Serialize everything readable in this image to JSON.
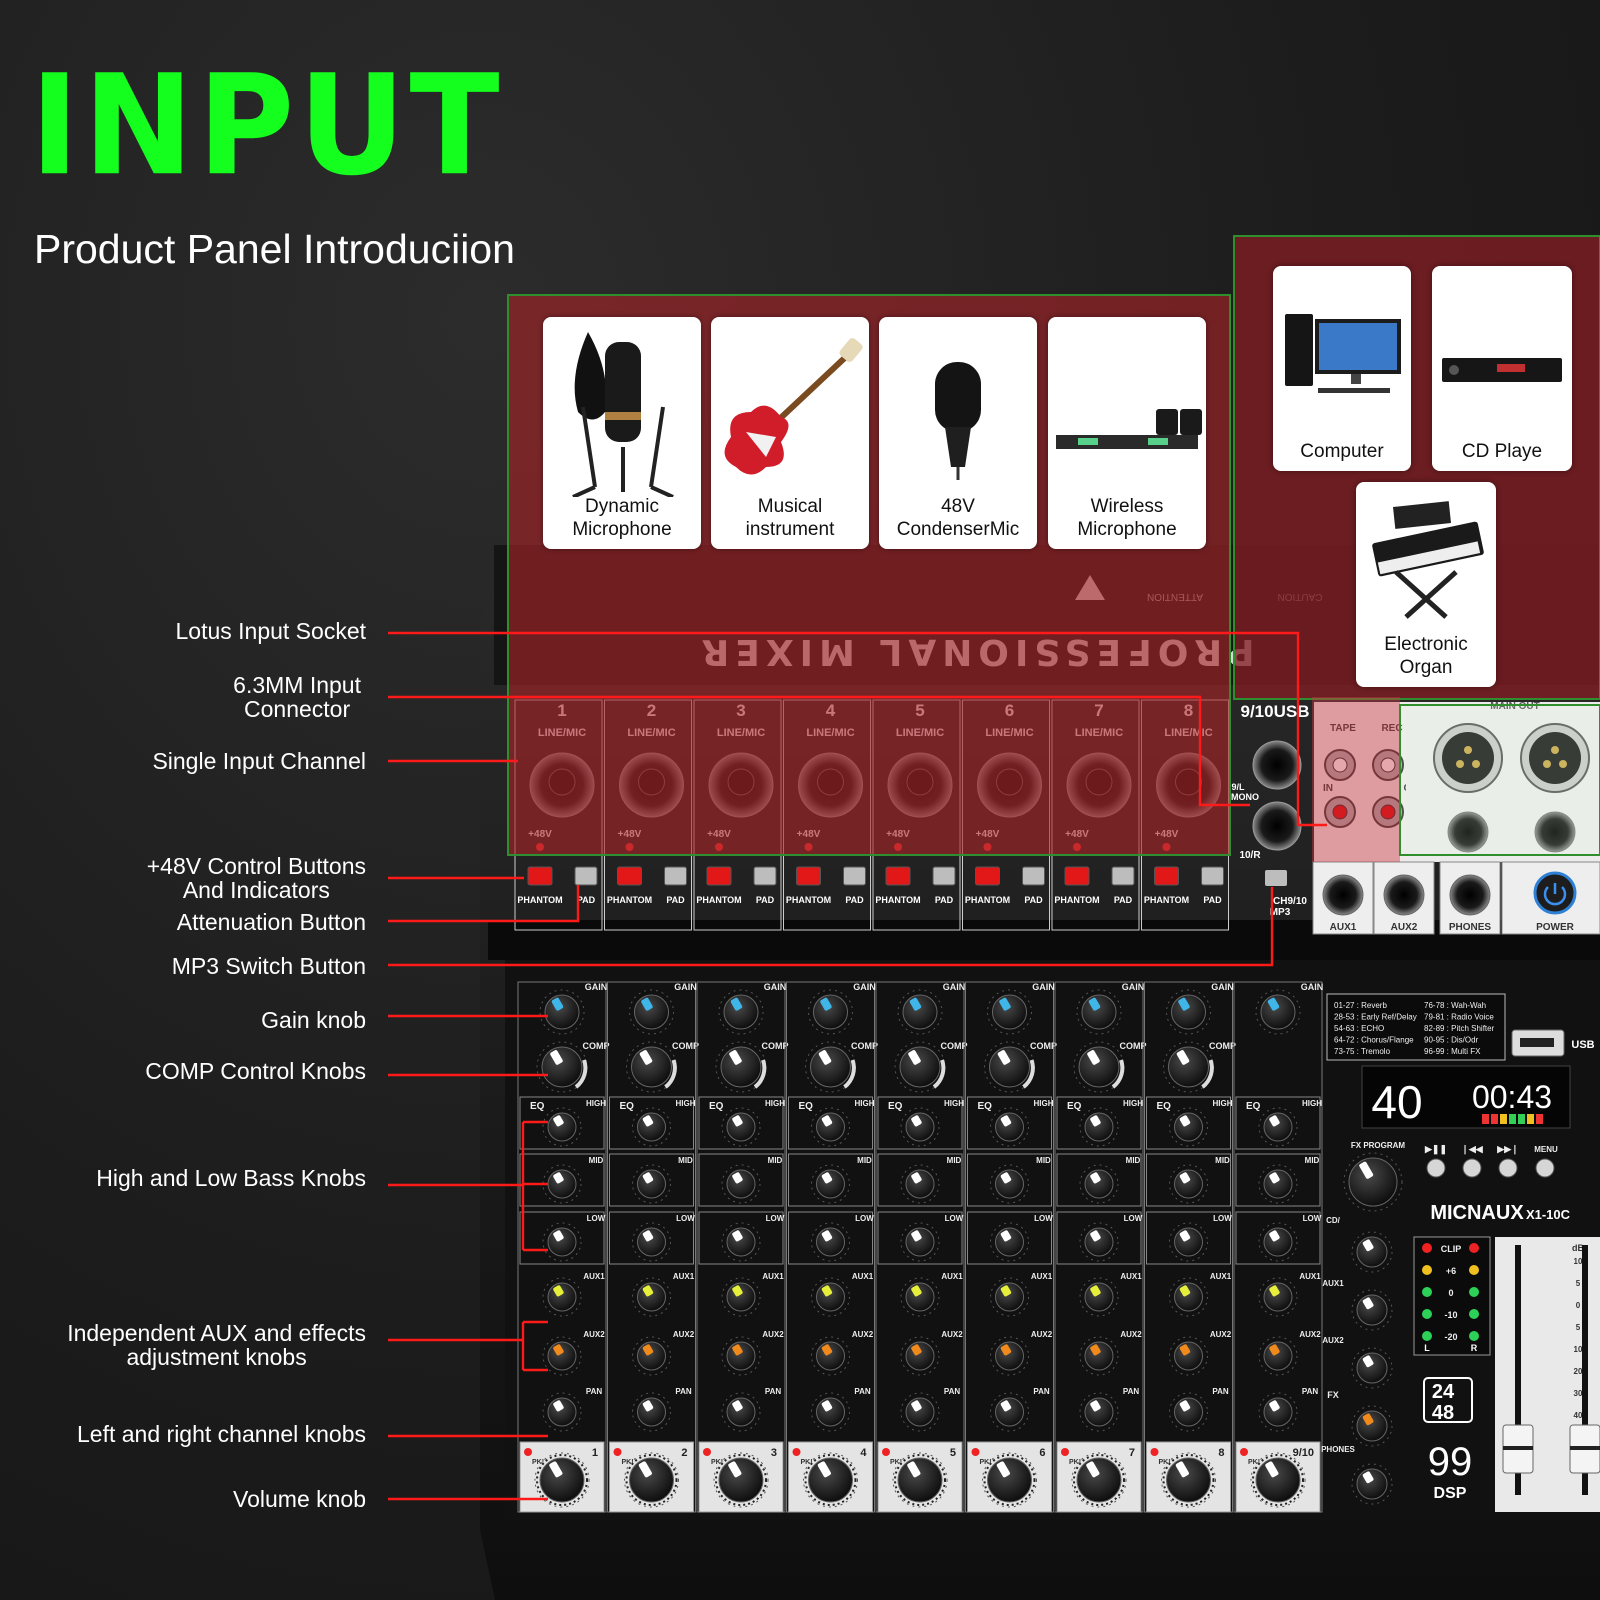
{
  "header": {
    "title": "INPUT",
    "subtitle": "Product Panel Introduciion"
  },
  "devices": {
    "dynamic_mic": "Dynamic\nMicrophone",
    "instrument": "Musical\ninstrument",
    "condenser": "48V\nCondenserMic",
    "wireless": "Wireless\nMicrophone",
    "computer": "Computer",
    "cd_player": "CD Playe",
    "organ": "Electronic\nOrgan"
  },
  "callouts": {
    "lotus": "Lotus Input Socket",
    "jack": "6.3MM Input\nConnector",
    "single_channel": "Single Input Channel",
    "phantom": "+48V Control Buttons\nAnd Indicators",
    "attenuation": "Attenuation Button",
    "mp3_switch": "MP3 Switch Button",
    "gain": "Gain knob",
    "comp": "COMP Control Knobs",
    "eq": "High and Low Bass Knobs",
    "aux": "Independent AUX and effects\nadjustment knobs",
    "pan": "Left and right channel knobs",
    "volume": "Volume knob"
  },
  "mixer": {
    "channel_numbers": [
      "1",
      "2",
      "3",
      "4",
      "5",
      "6",
      "7",
      "8"
    ],
    "usb_channel": "9/10USB",
    "line_mic": "LINE/MIC",
    "plus48": "+48V",
    "phantom": "PHANTOM",
    "pad": "PAD",
    "mono_label": "9/L\nMONO",
    "ten_r": "10/R",
    "mp3_label": "CH9/10\nMP3",
    "tape": "TAPE",
    "rec": "REC",
    "main_out": "MAIN OUT",
    "in": "IN",
    "out": "OUT",
    "aux1": "AUX1",
    "aux2": "AUX2",
    "phones": "PHONES",
    "power": "POWER",
    "top_text": "PROFESSIONAL MIXER",
    "caution": "CAUTION",
    "attention": "ATTENTION",
    "gain": "GAIN",
    "comp": "COMP",
    "eq": "EQ",
    "high": "HIGH",
    "mid": "MID",
    "low": "LOW",
    "aux1_knob": "AUX1",
    "aux2_fx": "AUX2\n/FX",
    "pan": "PAN",
    "pk": "PK!",
    "fx_list_left": [
      "01-27 : Reverb",
      "28-53 : Early Ref/Delay",
      "54-63 : ECHO",
      "64-72 : Chorus/Flange",
      "73-75 : Tremolo"
    ],
    "fx_list_right": [
      "76-78 : Wah-Wah",
      "79-81 : Radio Voice",
      "82-89 : Pitch Shifter",
      "90-95 : Dis/Odr",
      "96-99 : Multi FX"
    ],
    "usb": "USB",
    "display_program": "40",
    "display_time": "00:43",
    "fx_program": "FX PROGRAM",
    "menu": "MENU",
    "brand": "MICNAUX",
    "model": "X1-10C",
    "cd_tape": "CD/\nTAPE",
    "aux1_send": "AUX1\nSEND",
    "aux2_send": "AUX2\nSEND",
    "fx": "FX",
    "phones_knob": "PHONES",
    "meter_labels": [
      "CLIP",
      "+6",
      "0",
      "-10",
      "-20"
    ],
    "meter_l": "L",
    "meter_r": "R",
    "bit_24": "24",
    "khz_48": "48",
    "dsp_99": "99",
    "dsp": "DSP",
    "db": "dB",
    "fader_scale": [
      "10",
      "5",
      "0",
      "5",
      "10",
      "20",
      "30",
      "40",
      "50",
      "60"
    ]
  }
}
